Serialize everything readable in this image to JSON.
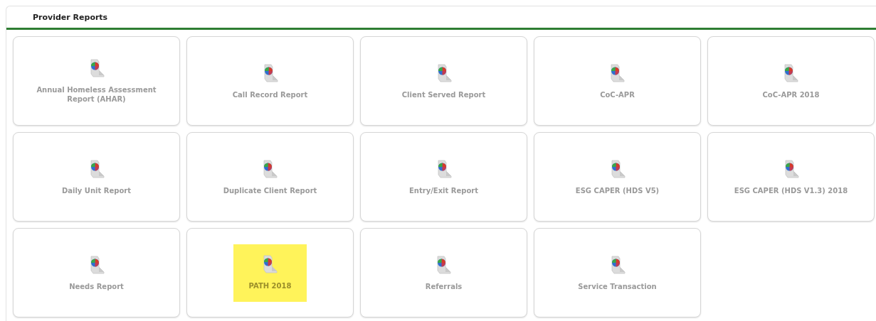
{
  "panel": {
    "title": "Provider Reports"
  },
  "reports": [
    {
      "label": "Annual Homeless Assessment Report (AHAR)",
      "highlighted": false
    },
    {
      "label": "Call Record Report",
      "highlighted": false
    },
    {
      "label": "Client Served Report",
      "highlighted": false
    },
    {
      "label": "CoC-APR",
      "highlighted": false
    },
    {
      "label": "CoC-APR 2018",
      "highlighted": false
    },
    {
      "label": "Daily Unit Report",
      "highlighted": false
    },
    {
      "label": "Duplicate Client Report",
      "highlighted": false
    },
    {
      "label": "Entry/Exit Report",
      "highlighted": false
    },
    {
      "label": "ESG CAPER (HDS V5)",
      "highlighted": false
    },
    {
      "label": "ESG CAPER (HDS V1.3) 2018",
      "highlighted": false
    },
    {
      "label": "Needs Report",
      "highlighted": false
    },
    {
      "label": "PATH 2018",
      "highlighted": true
    },
    {
      "label": "Referrals",
      "highlighted": false
    },
    {
      "label": "Service Transaction",
      "highlighted": false
    }
  ]
}
